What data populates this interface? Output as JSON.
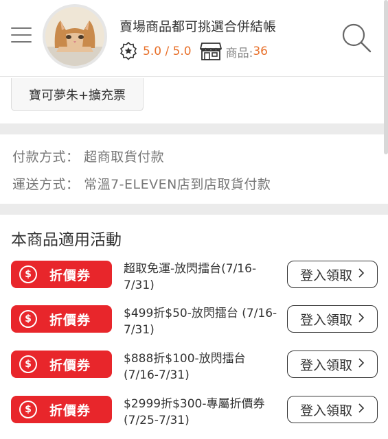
{
  "header": {
    "shop_title": "賣場商品都可挑選合併結帳",
    "rating": "5.0 / 5.0",
    "product_count_label": "商品:",
    "product_count": "36"
  },
  "variant": {
    "label": "寶可夢朱+擴充票"
  },
  "payment": {
    "label": "付款方式：",
    "value": "超商取貨付款"
  },
  "shipping": {
    "label": "運送方式：",
    "value": "常溫7-ELEVEN店到店取貨付款"
  },
  "promotions": {
    "title": "本商品適用活動",
    "items": [
      {
        "badge_symbol": "$",
        "badge_label": "折價券",
        "description": "超取免運-放閃擂台(7/16-7/31)",
        "button_label": "登入領取"
      },
      {
        "badge_symbol": "$",
        "badge_label": "折價券",
        "description": "$499折$50-放閃擂台 (7/16-7/31)",
        "button_label": "登入領取"
      },
      {
        "badge_symbol": "$",
        "badge_label": "折價券",
        "description": "$888折$100-放閃擂台(7/16-7/31)",
        "button_label": "登入領取"
      },
      {
        "badge_symbol": "$",
        "badge_label": "折價券",
        "description": "$2999折$300-專屬折價券(7/25-7/31)",
        "button_label": "登入領取"
      }
    ]
  },
  "colors": {
    "accent": "#e8702a",
    "coupon_red": "#e8262b",
    "divider": "#ebebeb"
  },
  "icons": {
    "menu": "hamburger-icon",
    "search": "search-icon",
    "rating": "award-ribbon-icon",
    "shop": "storefront-icon",
    "chevron": "chevron-right-icon"
  }
}
